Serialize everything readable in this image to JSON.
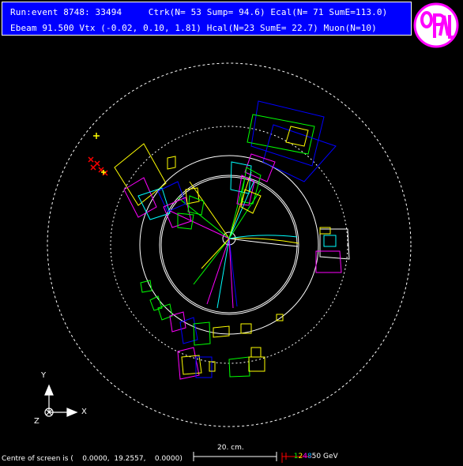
{
  "header": {
    "line1": "Run:event 8748: 33494     Ctrk(N= 53 Sump= 94.6) Ecal(N= 71 SumE=113.0)",
    "line2": "Ebeam 91.500 Vtx (-0.02, 0.10, 1.81) Hcal(N=23 SumE= 22.7) Muon(N=10)"
  },
  "logo": {
    "text": "OPAL",
    "color_ring": "#ff00ff",
    "color_bg": "#ffffff"
  },
  "axes": {
    "y": "Y",
    "x": "X",
    "z": "Z"
  },
  "footer": {
    "centre": "Centre of screen is (    0.0000,  19.2557,    0.0000)",
    "scale": "20. cm.",
    "energy_numbers": [
      "1",
      "2",
      "4",
      "8",
      "50 GeV"
    ],
    "energy_colors": [
      "#00ff00",
      "#ffff00",
      "#ff00ff",
      "#0000ff",
      "#ffffff"
    ]
  },
  "colors": {
    "header_bg": "#0000ff",
    "tracks": "#ffff00",
    "ecal": "#00ff00",
    "hcal": "#0000ff",
    "muon": "#ff0000",
    "extra": "#ff00ff",
    "cyan": "#00ffff"
  }
}
